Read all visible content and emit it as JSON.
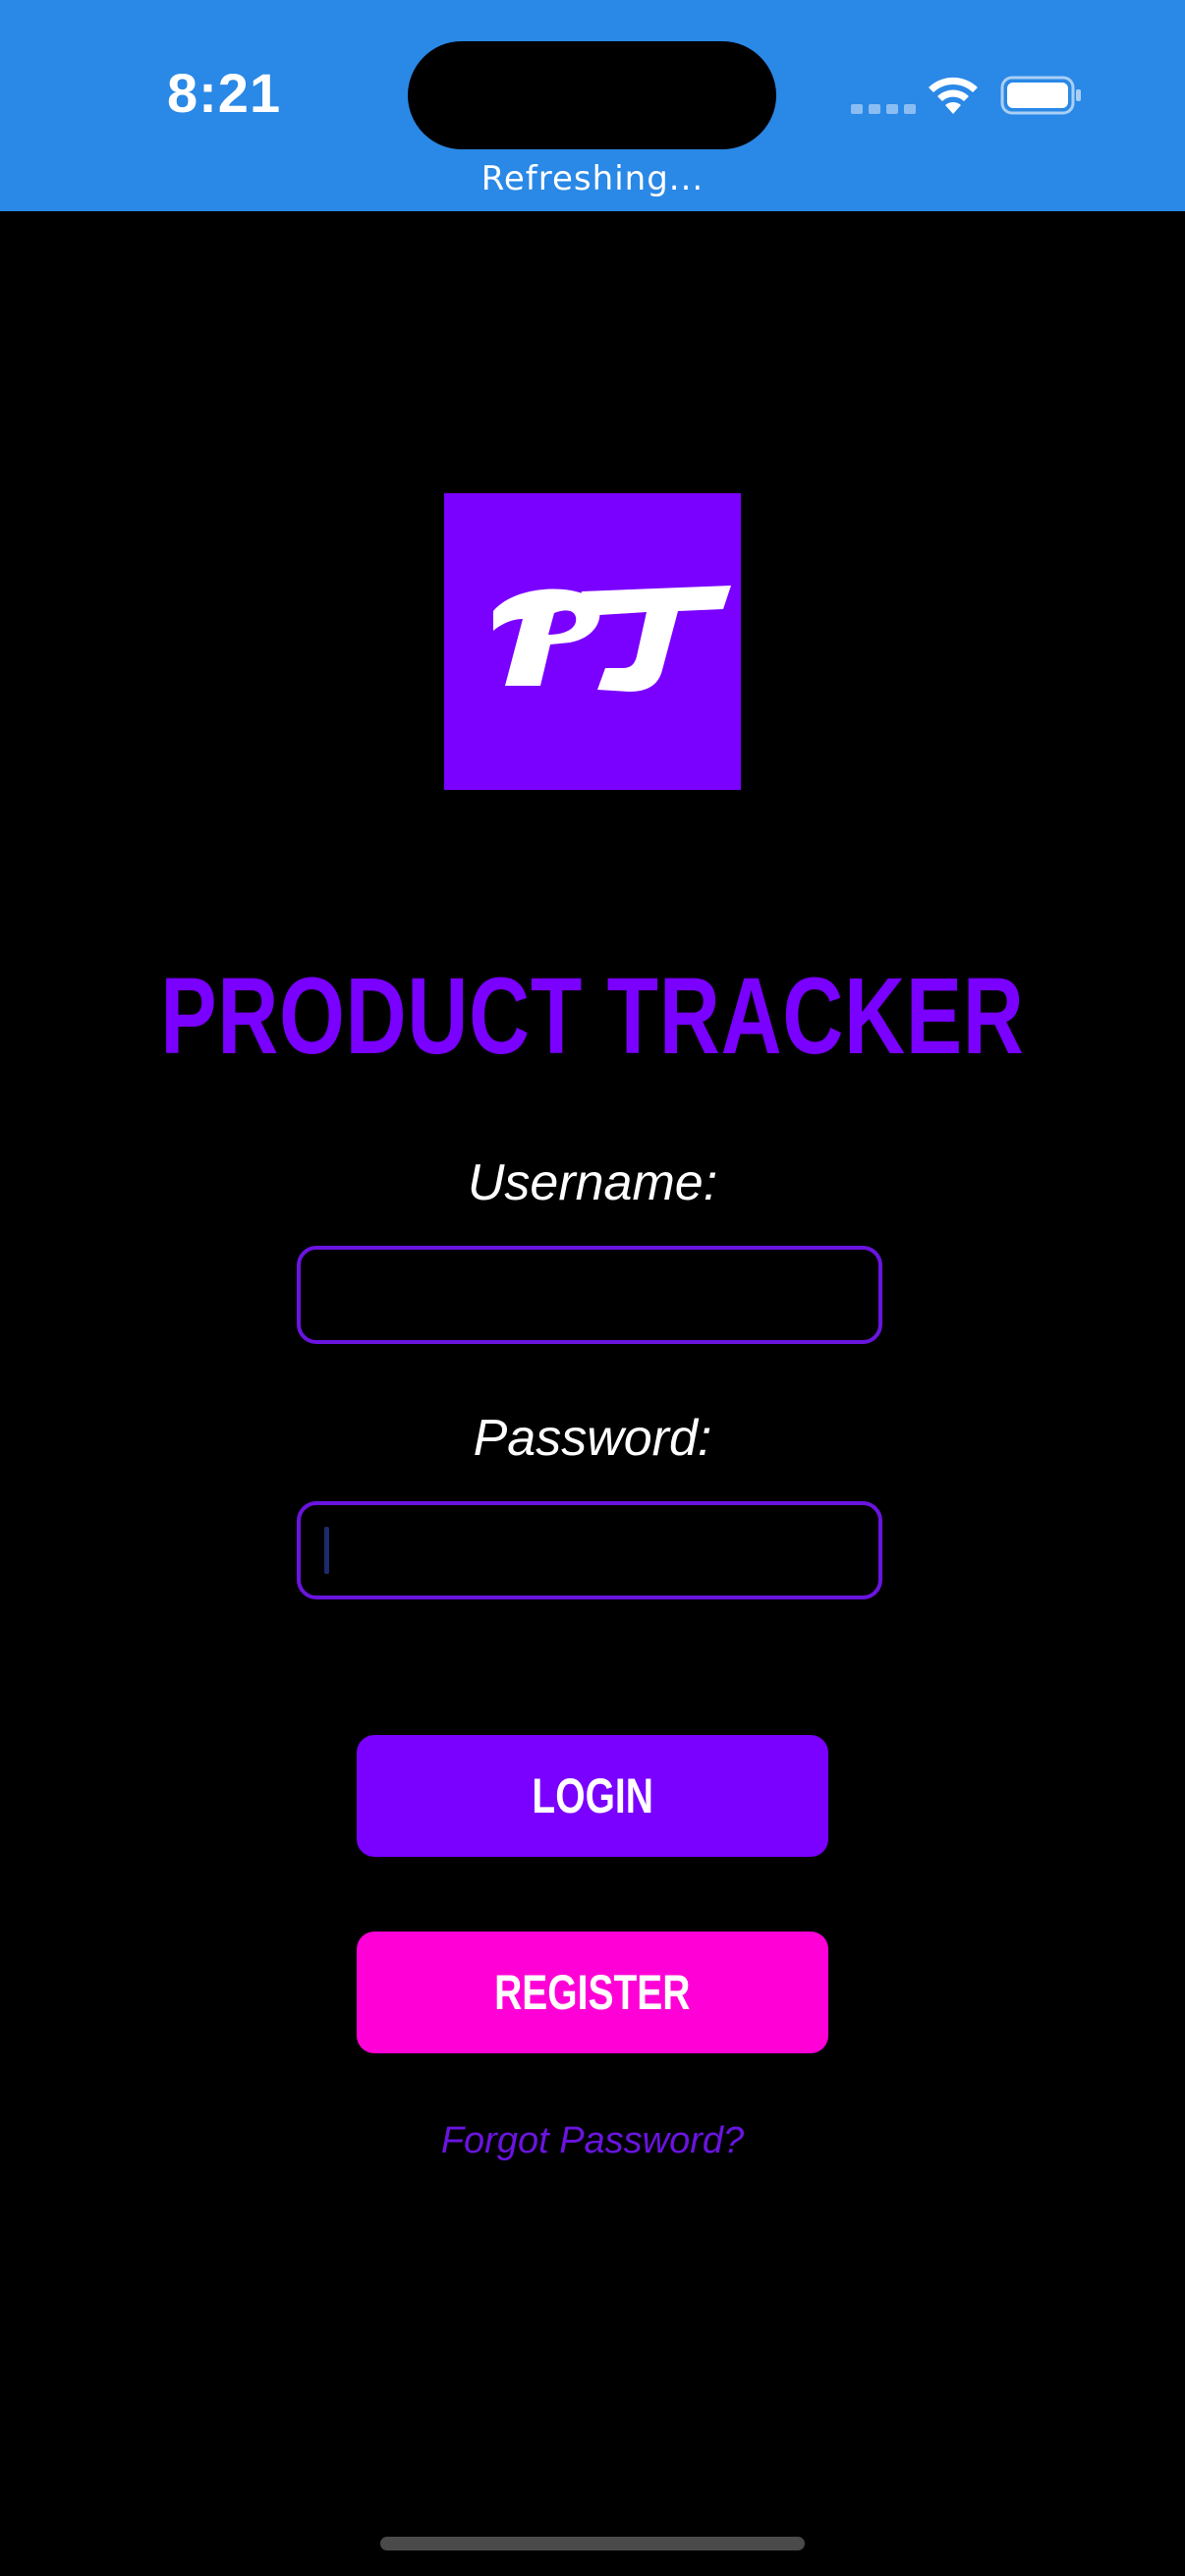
{
  "status_bar": {
    "time": "8:21",
    "background_color": "#2A88E6",
    "refresh_text": "Refreshing...",
    "icons": [
      "signal-dots-icon",
      "wifi-icon",
      "battery-icon"
    ]
  },
  "logo": {
    "mark_text": "PT",
    "background_color": "#7A00FF"
  },
  "app": {
    "title": "PRODUCT TRACKER",
    "title_color": "#7A00FF"
  },
  "form": {
    "username_label": "Username:",
    "username_value": "",
    "password_label": "Password:",
    "password_value": "",
    "field_border_color": "#6A14E0"
  },
  "buttons": {
    "login_label": "LOGIN",
    "login_color": "#7A00FF",
    "register_label": "REGISTER",
    "register_color": "#FF00D6"
  },
  "links": {
    "forgot_password": "Forgot Password?"
  }
}
